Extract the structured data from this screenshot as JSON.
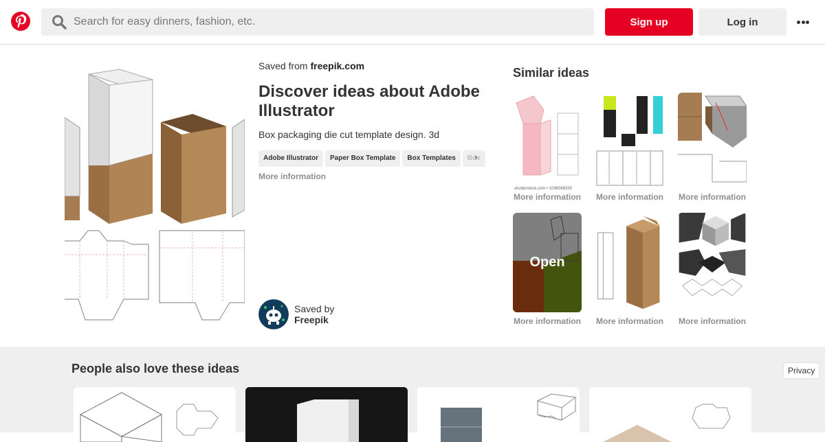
{
  "header": {
    "search_placeholder": "Search for easy dinners, fashion, etc.",
    "signup_label": "Sign up",
    "login_label": "Log in",
    "brand_color": "#e60023"
  },
  "pin": {
    "saved_from_prefix": "Saved from",
    "saved_from_site": "freepik.com",
    "title": "Discover ideas about Adobe Illustrator",
    "description": "Box packaging die cut template design. 3d",
    "tags": [
      "Adobe Illustrator",
      "Paper Box Template",
      "Box Templates",
      "Box"
    ],
    "more_info": "More information",
    "saved_by_prefix": "Saved by",
    "saved_by_name": "Freepik"
  },
  "similar": {
    "title": "Similar ideas",
    "items": [
      {
        "caption": "More information",
        "watermark": "shutterstock.com • 1098368330"
      },
      {
        "caption": "More information"
      },
      {
        "caption": "More information"
      },
      {
        "caption": "More information",
        "overlay": "Open"
      },
      {
        "caption": "More information"
      },
      {
        "caption": "More information"
      }
    ]
  },
  "bottom": {
    "title": "People also love these ideas",
    "privacy": "Privacy"
  }
}
